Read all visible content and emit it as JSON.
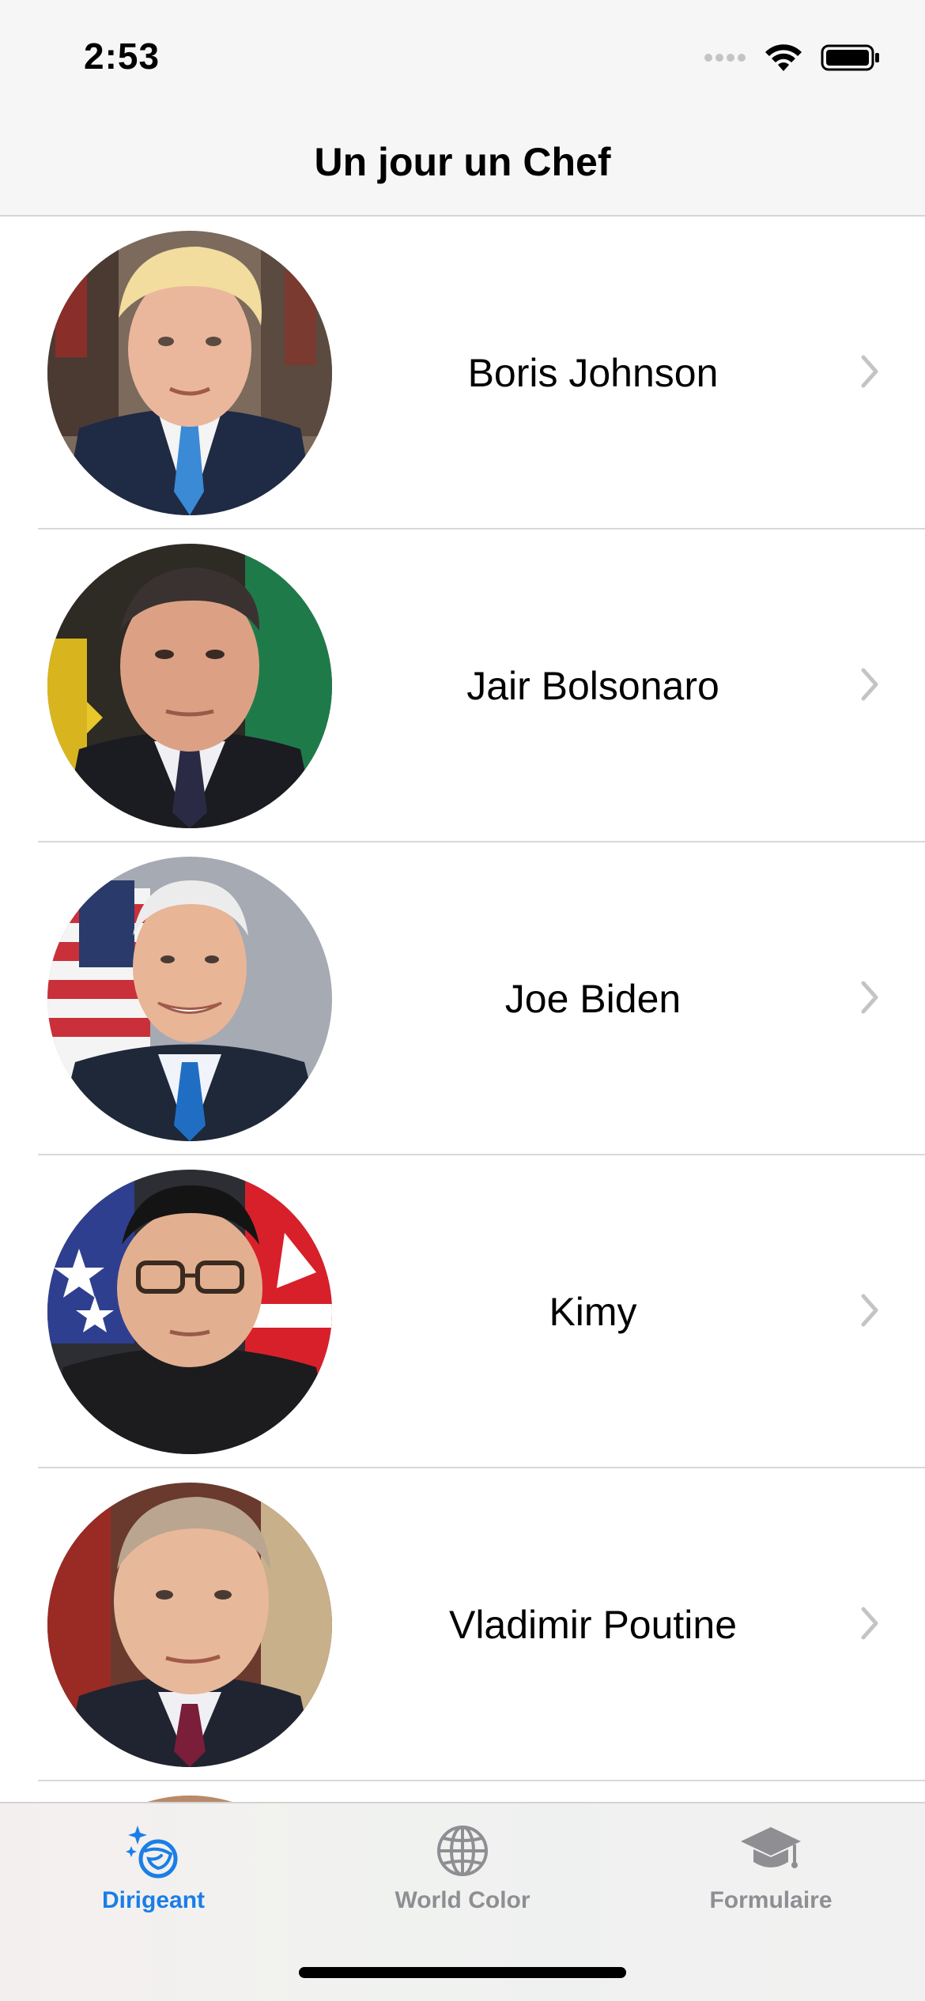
{
  "status_bar": {
    "time": "2:53",
    "icons": [
      "signal-dots-icon",
      "wifi-icon",
      "battery-icon"
    ]
  },
  "nav": {
    "title": "Un jour un Chef"
  },
  "leaders": [
    {
      "name": "Boris Johnson"
    },
    {
      "name": "Jair Bolsonaro"
    },
    {
      "name": "Joe Biden"
    },
    {
      "name": "Kimy"
    },
    {
      "name": "Vladimir Poutine"
    }
  ],
  "tabs": [
    {
      "label": "Dirigeant",
      "icon": "sparkle-globe-icon",
      "active": true
    },
    {
      "label": "World Color",
      "icon": "globe-icon",
      "active": false
    },
    {
      "label": "Formulaire",
      "icon": "graduation-cap-icon",
      "active": false
    }
  ],
  "colors": {
    "accent": "#1a7ee6",
    "inactive": "#8e8e93",
    "separator": "#d9d9dc"
  }
}
